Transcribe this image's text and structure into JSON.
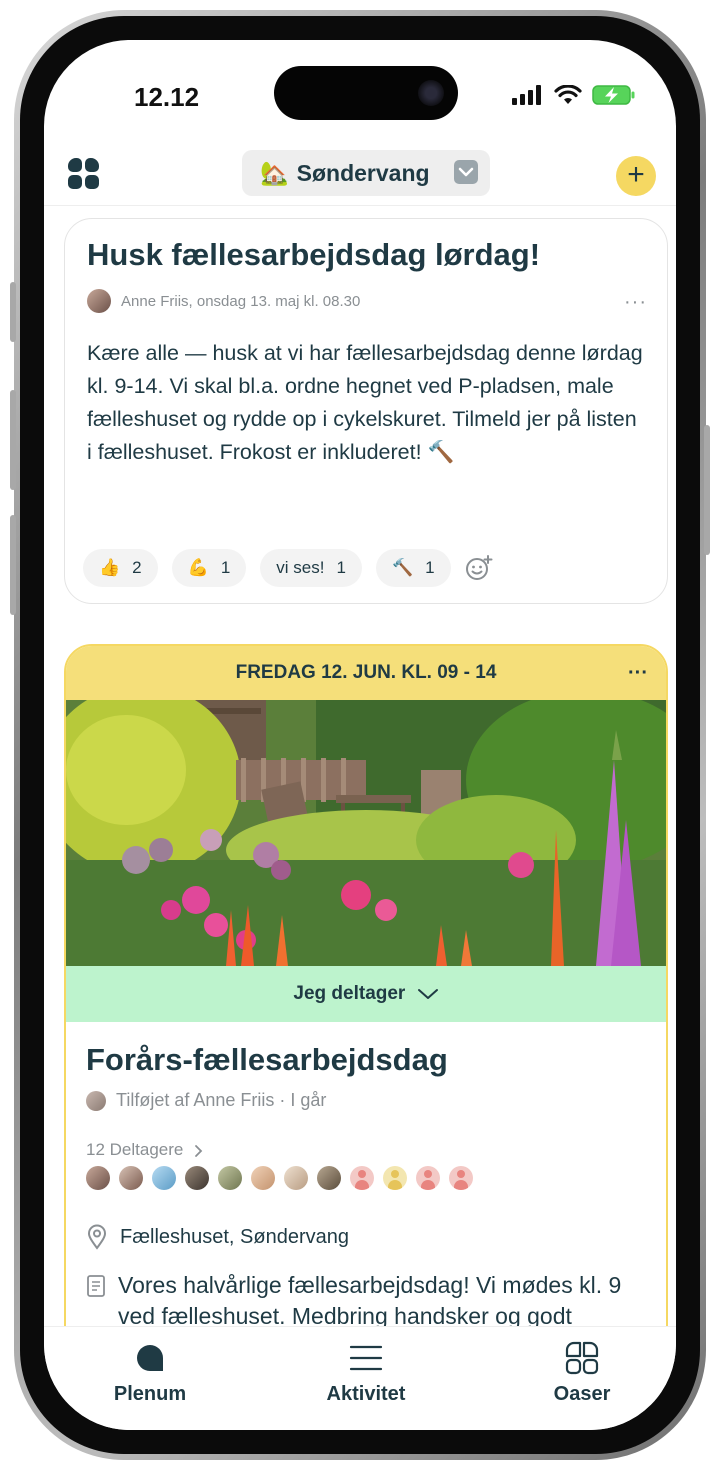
{
  "status_bar": {
    "time": "12.12"
  },
  "header": {
    "community_emoji": "🏡",
    "community_name": "Søndervang",
    "add_label": "+"
  },
  "post": {
    "title": "Husk fællesarbejdsdag lørdag!",
    "author": "Anne Friis",
    "date": "onsdag 13. maj kl. 08.30",
    "more": "···",
    "body": "Kære alle — husk at vi har fællesarbejdsdag denne lørdag kl. 9-14. Vi skal bl.a. ordne hegnet ved P-pladsen, male fælleshuset og rydde op i cykelskuret. Tilmeld jer på listen i fælleshuset. Frokost er inkluderet! 🔨",
    "reactions": [
      {
        "emoji": "👍",
        "label": "",
        "count": "2"
      },
      {
        "emoji": "💪",
        "label": "",
        "count": "1"
      },
      {
        "emoji": "",
        "label": "vi ses!",
        "count": "1"
      },
      {
        "emoji": "🔨",
        "label": "",
        "count": "1"
      }
    ]
  },
  "event": {
    "date_banner": "FREDAG 12. JUN. KL. 09 - 14",
    "more": "···",
    "rsvp_label": "Jeg deltager",
    "title": "Forårs-fællesarbejdsdag",
    "added_by": "Tilføjet af Anne Friis · I går",
    "participants_label": "12 Deltagere",
    "location": "Fælleshuset, Søndervang",
    "description": "Vores halvårlige fællesarbejdsdag! Vi mødes kl. 9 ved fælleshuset. Medbring handsker og godt humør. Frokost og kaffe er sponseret af"
  },
  "tabbar": {
    "tabs": [
      {
        "label": "Plenum",
        "icon": "chat-bubble-icon",
        "active": true
      },
      {
        "label": "Aktivitet",
        "icon": "list-icon",
        "active": false
      },
      {
        "label": "Oaser",
        "icon": "grid-icon",
        "active": false
      }
    ]
  },
  "colors": {
    "primary": "#1f3a44",
    "accent_yellow": "#f5d862",
    "rsvp_green": "#bdf3cd",
    "muted": "#8a8f93"
  }
}
